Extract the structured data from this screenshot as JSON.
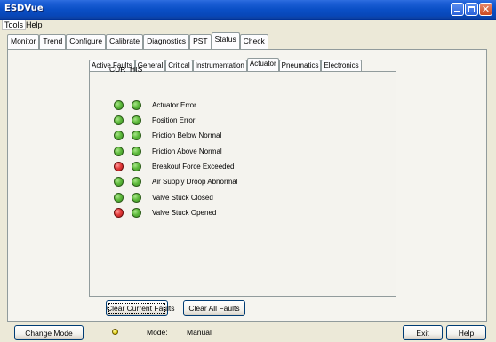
{
  "window": {
    "title": "ESDVue",
    "controls": {
      "minimize_icon": "minimize-icon",
      "maximize_icon": "maximize-icon",
      "close_icon": "close-icon"
    }
  },
  "menu": {
    "items": [
      {
        "label": "Tools"
      },
      {
        "label": "Help"
      }
    ]
  },
  "main_tabs": [
    {
      "label": "Monitor",
      "active": false
    },
    {
      "label": "Trend",
      "active": false
    },
    {
      "label": "Configure",
      "active": false
    },
    {
      "label": "Calibrate",
      "active": false
    },
    {
      "label": "Diagnostics",
      "active": false
    },
    {
      "label": "PST",
      "active": false
    },
    {
      "label": "Status",
      "active": true
    },
    {
      "label": "Check",
      "active": false
    }
  ],
  "sub_tabs": [
    {
      "label": "Active Faults",
      "active": false
    },
    {
      "label": "General",
      "active": false
    },
    {
      "label": "Critical",
      "active": false
    },
    {
      "label": "Instrumentation",
      "active": false
    },
    {
      "label": "Actuator",
      "active": true
    },
    {
      "label": "Pneumatics",
      "active": false
    },
    {
      "label": "Electronics",
      "active": false
    }
  ],
  "columns": {
    "cur": "CUR",
    "his": "HIS"
  },
  "faults": [
    {
      "label": "Actuator Error",
      "cur": "green",
      "his": "green"
    },
    {
      "label": "Position Error",
      "cur": "green",
      "his": "green"
    },
    {
      "label": "Friction Below Normal",
      "cur": "green",
      "his": "green"
    },
    {
      "label": "Friction Above Normal",
      "cur": "green",
      "his": "green"
    },
    {
      "label": "Breakout Force Exceeded",
      "cur": "red",
      "his": "green"
    },
    {
      "label": "Air Supply Droop Abnormal",
      "cur": "green",
      "his": "green"
    },
    {
      "label": "Valve Stuck Closed",
      "cur": "green",
      "his": "green"
    },
    {
      "label": "Valve Stuck Opened",
      "cur": "red",
      "his": "green"
    }
  ],
  "buttons": {
    "clear_current": "Clear Current Faults",
    "clear_all": "Clear All Faults",
    "change_mode": "Change Mode",
    "exit": "Exit",
    "help": "Help"
  },
  "status": {
    "mode_label": "Mode:",
    "mode_value": "Manual",
    "mode_indicator_color": "#e8dc20"
  },
  "colors": {
    "led_green": "#5fbb3d",
    "led_red": "#e33b3b",
    "title_bar": "#0a4fc6"
  }
}
